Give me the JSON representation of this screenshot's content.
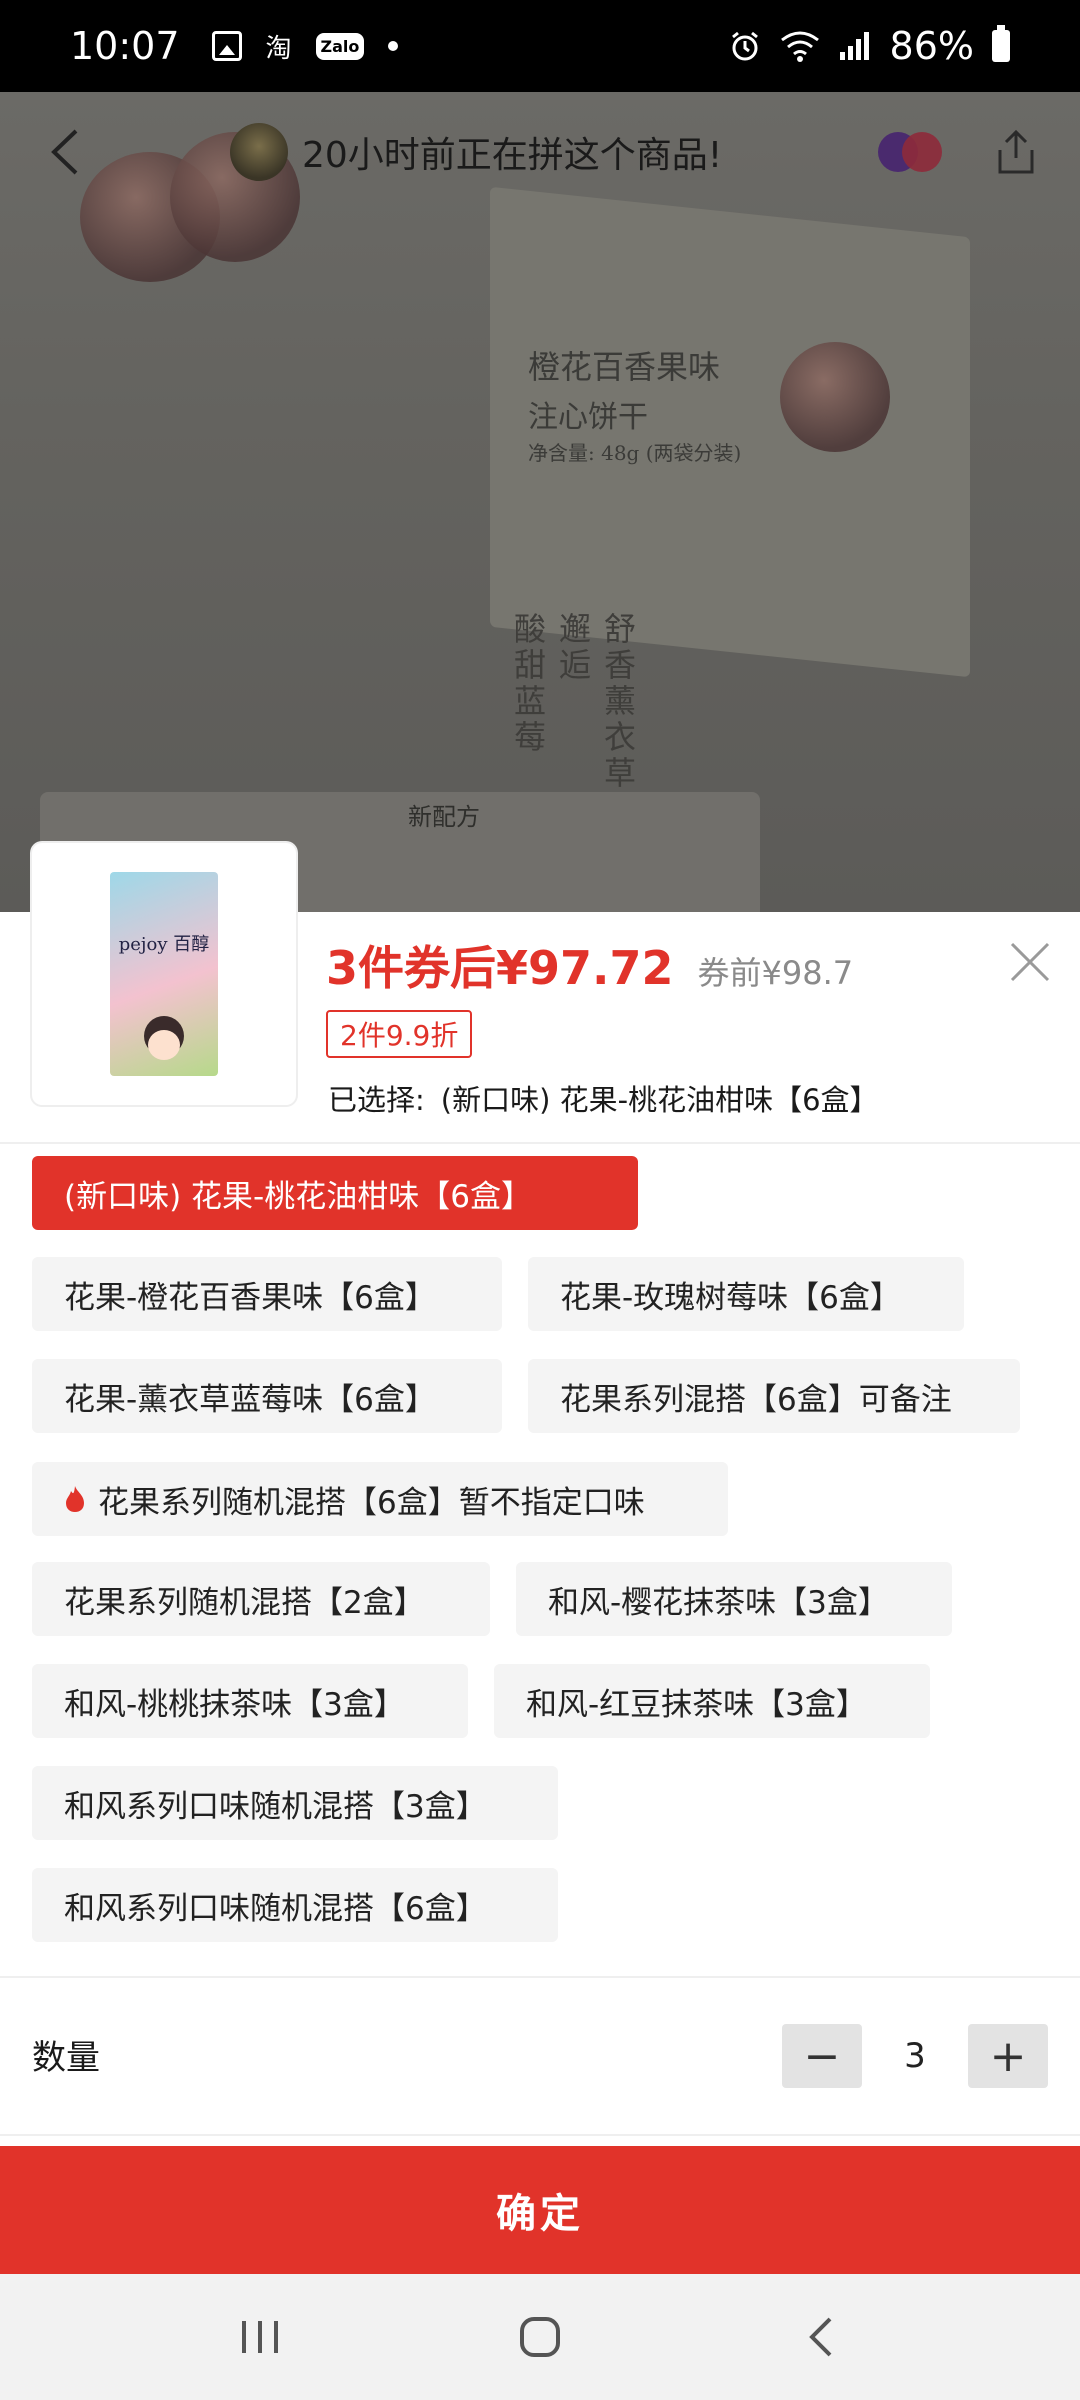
{
  "status_bar": {
    "time": "10:07",
    "battery": "86%",
    "notification_icons": [
      "gallery-icon",
      "taobao-icon",
      "zalo-icon",
      "dot-icon"
    ],
    "taobao_glyph": "淘",
    "zalo_label": "Zalo"
  },
  "header": {
    "title": "20小时前正在拼这个商品!"
  },
  "hero": {
    "texts": {
      "line1": "橙花百香果味",
      "line2": "注心饼干",
      "line3": "净含量: 48g (两袋分装)",
      "vert1": "舒香薰衣草",
      "vert2": "邂逅",
      "vert3": "酸甜蓝莓",
      "new_formula": "新配方"
    }
  },
  "product": {
    "thumb_brand": "pejoy 百醇",
    "price_main": "3件券后¥97.72",
    "price_before": "券前¥98.7",
    "promo": "2件9.9折",
    "selected_label": "已选择:",
    "selected_value": "(新口味) 花果-桃花油柑味【6盒】"
  },
  "options": [
    {
      "label": "(新口味) 花果-桃花油柑味【6盒】",
      "selected": true
    },
    {
      "label": "花果-橙花百香果味【6盒】"
    },
    {
      "label": "花果-玫瑰树莓味【6盒】"
    },
    {
      "label": "花果-薰衣草蓝莓味【6盒】"
    },
    {
      "label": "花果系列混搭【6盒】可备注"
    },
    {
      "label": "花果系列随机混搭【6盒】暂不指定口味",
      "hot": true
    },
    {
      "label": "花果系列随机混搭【2盒】"
    },
    {
      "label": "和风-樱花抹茶味【3盒】"
    },
    {
      "label": "和风-桃桃抹茶味【3盒】"
    },
    {
      "label": "和风-红豆抹茶味【3盒】"
    },
    {
      "label": "和风系列口味随机混搭【3盒】"
    },
    {
      "label": "和风系列口味随机混搭【6盒】"
    }
  ],
  "quantity": {
    "label": "数量",
    "value": "3",
    "minus": "−",
    "plus": "+"
  },
  "confirm_label": "确定",
  "colors": {
    "accent": "#e1332a",
    "option_bg": "#f4f4f4"
  }
}
